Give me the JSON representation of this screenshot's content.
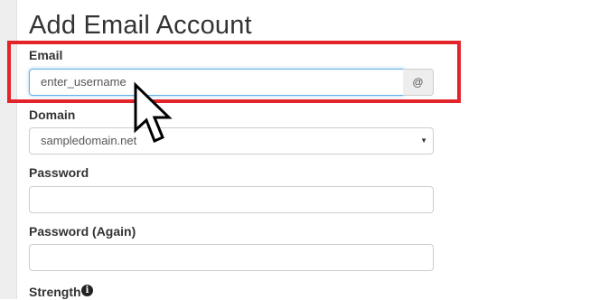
{
  "page": {
    "title": "Add Email Account"
  },
  "form": {
    "email": {
      "label": "Email",
      "value": "enter_username",
      "addon": "@"
    },
    "domain": {
      "label": "Domain",
      "selected": "sampledomain.net"
    },
    "password": {
      "label": "Password",
      "value": ""
    },
    "password_again": {
      "label": "Password (Again)",
      "value": ""
    },
    "strength": {
      "label": "Strength",
      "info_icon": "i"
    }
  },
  "colors": {
    "highlight": "#e3242b",
    "focus_border": "#66afe9"
  },
  "icons": {
    "info": "info-circle-icon",
    "cursor": "mouse-pointer-icon",
    "caret": "caret-down-icon"
  }
}
